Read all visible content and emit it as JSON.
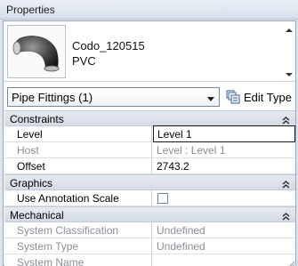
{
  "window": {
    "title": "Properties"
  },
  "type_preview": {
    "icon": "pipe-elbow-icon",
    "name": "Codo_120515",
    "material": "PVC"
  },
  "selector": {
    "value": "Pipe Fittings (1)"
  },
  "edit_type": {
    "label": "Edit Type",
    "icon": "edit-type-icon"
  },
  "groups": {
    "constraints": {
      "label": "Constraints",
      "rows": [
        {
          "name": "Level",
          "value": "Level 1"
        },
        {
          "name": "Host",
          "value": "Level : Level 1"
        },
        {
          "name": "Offset",
          "value": "2743.2"
        }
      ]
    },
    "graphics": {
      "label": "Graphics",
      "rows": [
        {
          "name": "Use Annotation Scale",
          "checked": false
        }
      ]
    },
    "mechanical": {
      "label": "Mechanical",
      "rows": [
        {
          "name": "System Classification",
          "value": "Undefined"
        },
        {
          "name": "System Type",
          "value": "Undefined"
        },
        {
          "name": "System Name",
          "value": ""
        }
      ]
    }
  },
  "colors": {
    "title_bar": "#dde4ee",
    "group_header": "#dbe1ea",
    "disabled_text": "#8a8f96"
  }
}
